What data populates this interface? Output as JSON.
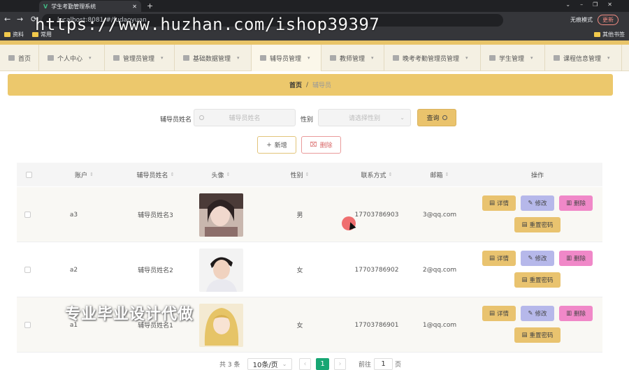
{
  "browser": {
    "tab_title": "学生考勤管理系统",
    "url": "localhost:8081/#/fudaoyuan",
    "incognito": "无痕模式",
    "update": "更新",
    "bookmarks": [
      "资料",
      "常用"
    ],
    "other_bookmarks": "其他书签"
  },
  "watermark": "https://www.huzhan.com/ishop39397",
  "nav": {
    "items": [
      {
        "label": "首页",
        "icon": "home-icon"
      },
      {
        "label": "个人中心",
        "icon": "user-icon"
      },
      {
        "label": "管理员管理",
        "icon": "mail-icon"
      },
      {
        "label": "基础数据管理",
        "icon": "grid-icon"
      },
      {
        "label": "辅导员管理",
        "icon": "folder-icon"
      },
      {
        "label": "教师管理",
        "icon": "grid-icon"
      },
      {
        "label": "晚考考勤管理员管理",
        "icon": "chart-icon"
      },
      {
        "label": "学生管理",
        "icon": "user-icon"
      },
      {
        "label": "课程信息管理",
        "icon": "grid-icon"
      }
    ],
    "active_index": 4
  },
  "breadcrumb": {
    "home": "首页",
    "separator": "/",
    "current": "辅导员"
  },
  "search": {
    "name_label": "辅导员姓名",
    "name_placeholder": "辅导员姓名",
    "gender_label": "性别",
    "gender_placeholder": "请选择性别",
    "query_button": "查询"
  },
  "actions": {
    "add": "新增",
    "delete": "删除"
  },
  "table": {
    "headers": [
      "账户",
      "辅导员姓名",
      "头像",
      "性别",
      "联系方式",
      "邮箱",
      "操作"
    ],
    "rows": [
      {
        "account": "a3",
        "name": "辅导员姓名3",
        "gender": "男",
        "phone": "17703786903",
        "email": "3@qq.com"
      },
      {
        "account": "a2",
        "name": "辅导员姓名2",
        "gender": "女",
        "phone": "17703786902",
        "email": "2@qq.com"
      },
      {
        "account": "a1",
        "name": "辅导员姓名1",
        "gender": "女",
        "phone": "17703786901",
        "email": "1@qq.com"
      }
    ],
    "row_buttons": {
      "detail": "详情",
      "edit": "修改",
      "delete": "删除",
      "reset": "重置密码"
    }
  },
  "overlay": "专业毕业设计代做",
  "pagination": {
    "total": "共 3 条",
    "page_size": "10条/页",
    "current_page": "1",
    "goto_label": "前往",
    "goto_value": "1",
    "page_suffix": "页"
  },
  "colors": {
    "accent": "#ecc86c",
    "pager_active": "#17a673",
    "edit": "#b6b8ea",
    "delete": "#f088c8"
  }
}
